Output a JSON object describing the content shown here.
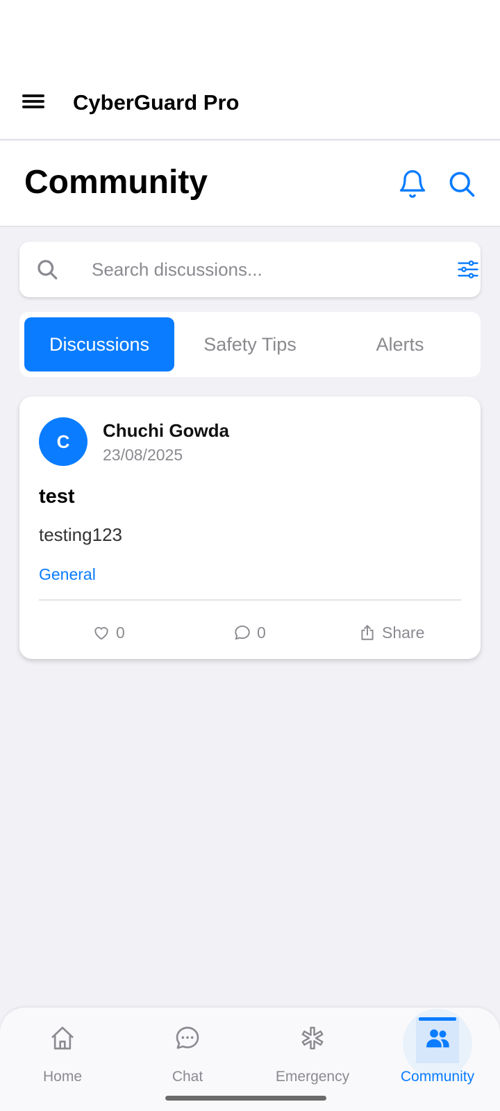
{
  "app": {
    "title": "CyberGuard Pro"
  },
  "header": {
    "title": "Community"
  },
  "search": {
    "placeholder": "Search discussions..."
  },
  "tabs": [
    {
      "label": "Discussions",
      "active": true
    },
    {
      "label": "Safety Tips",
      "active": false
    },
    {
      "label": "Alerts",
      "active": false
    }
  ],
  "posts": [
    {
      "avatar_initial": "C",
      "author": "Chuchi Gowda",
      "date": "23/08/2025",
      "title": "test",
      "body": "testing123",
      "category": "General",
      "likes": "0",
      "comments": "0",
      "share_label": "Share"
    }
  ],
  "nav": [
    {
      "label": "Home",
      "icon": "home-icon"
    },
    {
      "label": "Chat",
      "icon": "chat-icon"
    },
    {
      "label": "Emergency",
      "icon": "emergency-icon"
    },
    {
      "label": "Community",
      "icon": "community-icon",
      "active": true
    }
  ],
  "colors": {
    "accent": "#0a7cff",
    "background": "#f1f1f6",
    "muted": "#8a8a90"
  }
}
